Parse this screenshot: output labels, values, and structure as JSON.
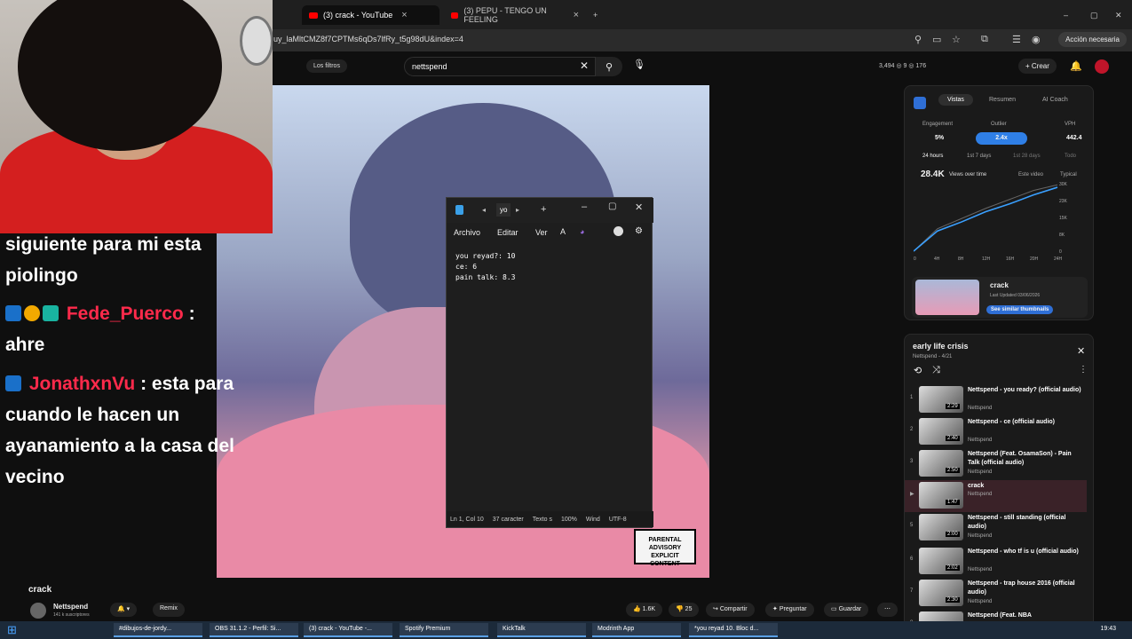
{
  "browser": {
    "tabs": [
      {
        "label": "(3) crack - YouTube"
      },
      {
        "label": "(3) PEPU - TENGO UN FEELING"
      }
    ],
    "url": "uy_laMltCMZ8f7CPTMs6qDs7lfRy_t5g98dU&index=4",
    "action_label": "Acción necesaria"
  },
  "yt": {
    "filters": "Los filtros",
    "search_value": "nettspend",
    "stats": "3,494  ◎ 9  ◎ 176",
    "create": "Crear"
  },
  "chat": {
    "line1": "siguiente para mi esta",
    "line2": "piolingo",
    "user1": "Fede_Puerco",
    "user1_msg": "ahre",
    "user2": "JonathxnVu",
    "user2_msg1": ": esta para",
    "user2_msg2": "cuando le hacen un",
    "user2_msg3": "ayanamiento a la casa del",
    "user2_msg4": "vecino"
  },
  "video": {
    "advisory": "PARENTAL ADVISORY EXPLICIT CONTENT"
  },
  "notepad": {
    "tab": "yo",
    "menu": [
      "Archivo",
      "Editar",
      "Ver"
    ],
    "text": "you reyad?: 10\nce: 6\npain talk: 8.3",
    "status": [
      "Ln 1, Col 10",
      "37 caracter",
      "Texto s",
      "100%",
      "Wind",
      "UTF-8"
    ]
  },
  "panel": {
    "tabs": [
      "Vistas",
      "Resumen",
      "AI Coach"
    ],
    "metrics": [
      {
        "label": "Engagement",
        "value": "5%"
      },
      {
        "label": "Outlier",
        "value": "2.4x"
      },
      {
        "label": "VPH",
        "value": "442.4"
      }
    ],
    "ranges": [
      "24 hours",
      "1st 7 days",
      "1st 28 days",
      "Todo"
    ],
    "views": "28.4K",
    "views_label": "Views over time",
    "legend": [
      "Este video",
      "Typical"
    ],
    "y_ticks": [
      "30K",
      "23K",
      "15K",
      "8K",
      "0"
    ],
    "x_ticks": [
      "0",
      "4H",
      "8H",
      "12H",
      "16H",
      "20H",
      "24H"
    ],
    "card_title": "crack",
    "card_sub": "Last Updated 03/06/2026",
    "card_btn": "See similar thumbnails"
  },
  "chart_data": {
    "type": "line",
    "x": [
      0,
      4,
      8,
      12,
      16,
      20,
      24
    ],
    "series": [
      {
        "name": "Este video",
        "values": [
          0,
          9000,
          13000,
          17500,
          21000,
          25000,
          28400
        ]
      },
      {
        "name": "Typical",
        "values": [
          0,
          10000,
          14500,
          19000,
          23000,
          27000,
          29500
        ]
      }
    ],
    "ylim": [
      0,
      30000
    ]
  },
  "playlist": {
    "title": "early life crisis",
    "sub": "Nettspend - 4/21",
    "items": [
      {
        "num": "1",
        "title": "Nettspend - you ready? (official audio)",
        "channel": "Nettspend",
        "dur": "2:29"
      },
      {
        "num": "2",
        "title": "Nettspend - ce (official audio)",
        "channel": "Nettspend",
        "dur": "2:40"
      },
      {
        "num": "3",
        "title": "Nettspend (Feat. OsamaSon) - Pain Talk (official audio)",
        "channel": "Nettspend",
        "dur": "2:50"
      },
      {
        "num": "▶",
        "title": "crack",
        "channel": "Nettspend",
        "dur": "1:47"
      },
      {
        "num": "5",
        "title": "Nettspend - still standing (official audio)",
        "channel": "Nettspend",
        "dur": "2:00"
      },
      {
        "num": "6",
        "title": "Nettspend - who tf is u (official audio)",
        "channel": "Nettspend",
        "dur": "2:02"
      },
      {
        "num": "7",
        "title": "Nettspend - trap house 2016 (official audio)",
        "channel": "Nettspend",
        "dur": "2:30"
      },
      {
        "num": "8",
        "title": "Nettspend (Feat. NBA",
        "channel": "",
        "dur": ""
      }
    ]
  },
  "video_info": {
    "title": "crack",
    "channel": "Nettspend",
    "subs": "141 k suscriptores",
    "remix": "Remix",
    "likes": "1.6K",
    "dislikes": "25",
    "share": "Compartir",
    "ask": "Preguntar",
    "save": "Guardar"
  },
  "taskbar": {
    "items": [
      "#dibujos-de-jordy...",
      "OBS 31.1.2 - Perfil: Si...",
      "(3) crack - YouTube -...",
      "Spotify Premium",
      "KickTalk",
      "Modrinth App",
      "*you reyad 10. Bloc d..."
    ],
    "clock": "19:43"
  }
}
